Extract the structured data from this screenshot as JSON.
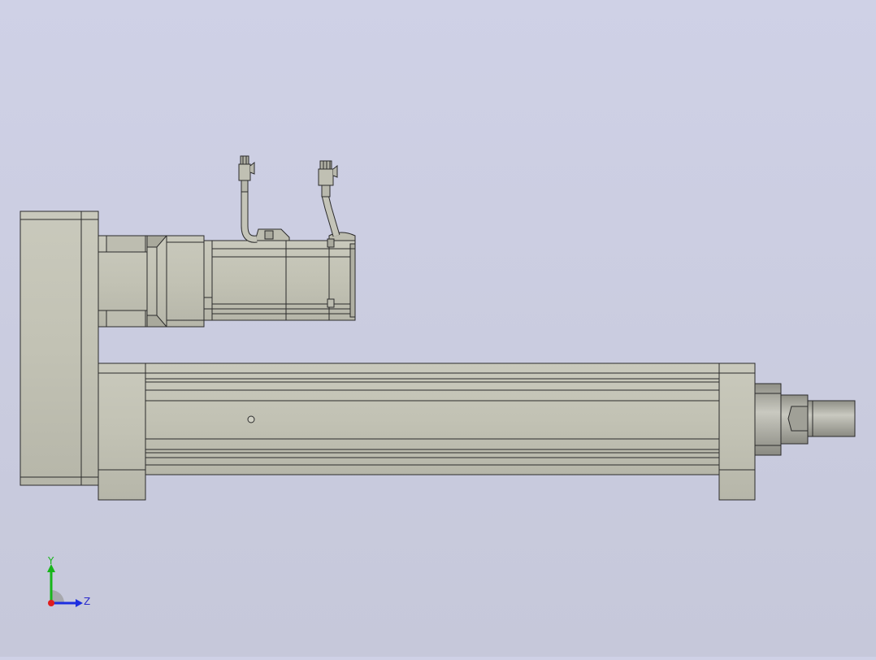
{
  "colors": {
    "background_top": "#cfd1e6",
    "background_bottom": "#c6c8da",
    "part_fill": "#c4c4b6",
    "part_shade": "#a9a99c",
    "edge": "#2b2b2b",
    "axis_y": "#17b51a",
    "axis_z": "#1d2ee0",
    "axis_x": "#e01d1d"
  },
  "triad": {
    "y_label": "Y",
    "z_label": "Z"
  },
  "model": {
    "icon_names": [
      "linear-actuator",
      "servo-motor",
      "gearbox",
      "cable-connector",
      "end-rod"
    ]
  }
}
